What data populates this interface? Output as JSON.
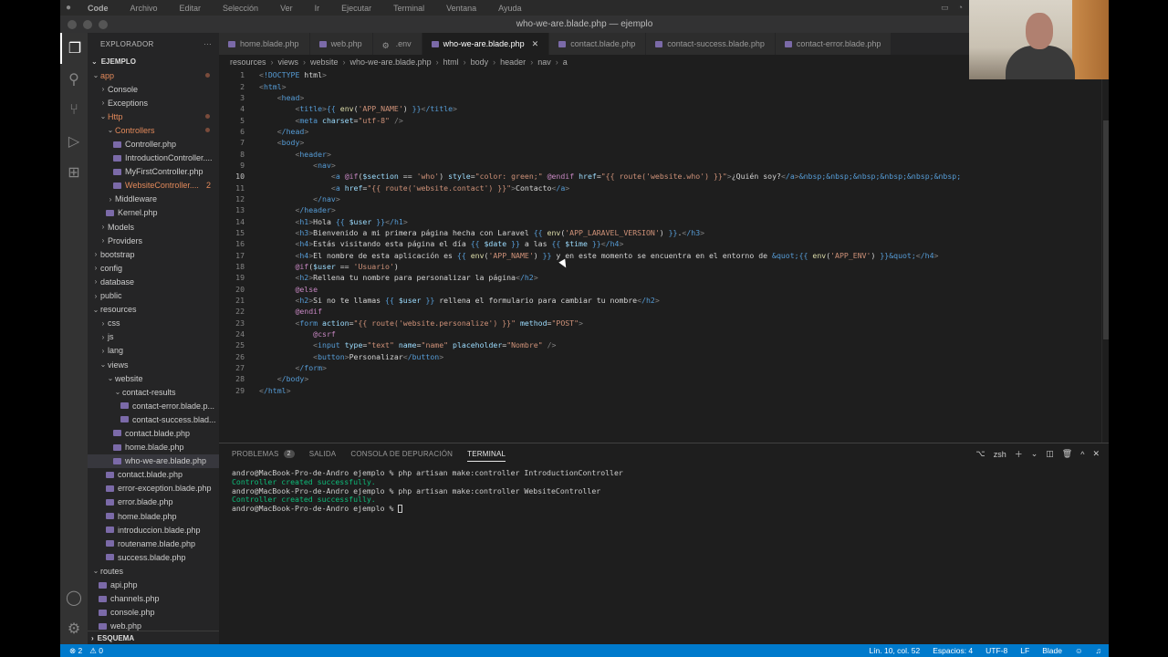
{
  "menubar": {
    "items": [
      "Code",
      "Archivo",
      "Editar",
      "Selección",
      "Ver",
      "Ir",
      "Ejecutar",
      "Terminal",
      "Ventana",
      "Ayuda"
    ]
  },
  "window": {
    "title": "who-we-are.blade.php — ejemplo"
  },
  "sidebar": {
    "header": "EXPLORADOR",
    "project": "EJEMPLO",
    "outline": "ESQUEMA",
    "tree": [
      {
        "label": "app",
        "depth": 0,
        "type": "folder-open",
        "orange": true,
        "dot": true
      },
      {
        "label": "Console",
        "depth": 1,
        "type": "folder"
      },
      {
        "label": "Exceptions",
        "depth": 1,
        "type": "folder"
      },
      {
        "label": "Http",
        "depth": 1,
        "type": "folder-open",
        "orange": true,
        "dot": true
      },
      {
        "label": "Controllers",
        "depth": 2,
        "type": "folder-open",
        "orange": true,
        "dot": true
      },
      {
        "label": "Controller.php",
        "depth": 3,
        "type": "file"
      },
      {
        "label": "IntroductionController....",
        "depth": 3,
        "type": "file"
      },
      {
        "label": "MyFirstController.php",
        "depth": 3,
        "type": "file"
      },
      {
        "label": "WebsiteController....",
        "depth": 3,
        "type": "file",
        "orange": true,
        "badge": "2"
      },
      {
        "label": "Middleware",
        "depth": 2,
        "type": "folder"
      },
      {
        "label": "Kernel.php",
        "depth": 2,
        "type": "file"
      },
      {
        "label": "Models",
        "depth": 1,
        "type": "folder"
      },
      {
        "label": "Providers",
        "depth": 1,
        "type": "folder"
      },
      {
        "label": "bootstrap",
        "depth": 0,
        "type": "folder"
      },
      {
        "label": "config",
        "depth": 0,
        "type": "folder"
      },
      {
        "label": "database",
        "depth": 0,
        "type": "folder"
      },
      {
        "label": "public",
        "depth": 0,
        "type": "folder"
      },
      {
        "label": "resources",
        "depth": 0,
        "type": "folder-open"
      },
      {
        "label": "css",
        "depth": 1,
        "type": "folder"
      },
      {
        "label": "js",
        "depth": 1,
        "type": "folder"
      },
      {
        "label": "lang",
        "depth": 1,
        "type": "folder"
      },
      {
        "label": "views",
        "depth": 1,
        "type": "folder-open"
      },
      {
        "label": "website",
        "depth": 2,
        "type": "folder-open"
      },
      {
        "label": "contact-results",
        "depth": 3,
        "type": "folder-open"
      },
      {
        "label": "contact-error.blade.p...",
        "depth": 4,
        "type": "file"
      },
      {
        "label": "contact-success.blad...",
        "depth": 4,
        "type": "file"
      },
      {
        "label": "contact.blade.php",
        "depth": 3,
        "type": "file"
      },
      {
        "label": "home.blade.php",
        "depth": 3,
        "type": "file"
      },
      {
        "label": "who-we-are.blade.php",
        "depth": 3,
        "type": "file",
        "selected": true
      },
      {
        "label": "contact.blade.php",
        "depth": 2,
        "type": "file"
      },
      {
        "label": "error-exception.blade.php",
        "depth": 2,
        "type": "file"
      },
      {
        "label": "error.blade.php",
        "depth": 2,
        "type": "file"
      },
      {
        "label": "home.blade.php",
        "depth": 2,
        "type": "file"
      },
      {
        "label": "introduccion.blade.php",
        "depth": 2,
        "type": "file"
      },
      {
        "label": "routename.blade.php",
        "depth": 2,
        "type": "file"
      },
      {
        "label": "success.blade.php",
        "depth": 2,
        "type": "file"
      },
      {
        "label": "routes",
        "depth": 0,
        "type": "folder-open"
      },
      {
        "label": "api.php",
        "depth": 1,
        "type": "file"
      },
      {
        "label": "channels.php",
        "depth": 1,
        "type": "file"
      },
      {
        "label": "console.php",
        "depth": 1,
        "type": "file"
      },
      {
        "label": "web.php",
        "depth": 1,
        "type": "file"
      }
    ]
  },
  "tabs": [
    {
      "label": "home.blade.php",
      "active": false
    },
    {
      "label": "web.php",
      "active": false
    },
    {
      "label": ".env",
      "active": false
    },
    {
      "label": "who-we-are.blade.php",
      "active": true
    },
    {
      "label": "contact.blade.php",
      "active": false
    },
    {
      "label": "contact-success.blade.php",
      "active": false
    },
    {
      "label": "contact-error.blade.php",
      "active": false
    }
  ],
  "breadcrumb": [
    "resources",
    "views",
    "website",
    "who-we-are.blade.php",
    "html",
    "body",
    "header",
    "nav",
    "a"
  ],
  "editor": {
    "current_line": 10,
    "lines": [
      "<!DOCTYPE html>",
      "<html>",
      "    <head>",
      "        <title>{{ env('APP_NAME') }}</title>",
      "        <meta charset=\"utf-8\" />",
      "    </head>",
      "    <body>",
      "        <header>",
      "            <nav>",
      "                <a @if($section == 'who') style=\"color: green;\" @endif href=\"{{ route('website.who') }}\">¿Quién soy?</a>&nbsp;&nbsp;&nbsp;&nbsp;&nbsp;&nbsp;",
      "                <a href=\"{{ route('website.contact') }}\">Contacto</a>",
      "            </nav>",
      "        </header>",
      "        <h1>Hola {{ $user }}</h1>",
      "        <h3>Bienvenido a mi primera página hecha con Laravel {{ env('APP_LARAVEL_VERSION') }}.</h3>",
      "        <h4>Estás visitando esta página el día {{ $date }} a las {{ $time }}</h4>",
      "        <h4>El nombre de esta aplicación es {{ env('APP_NAME') }} y en este momento se encuentra en el entorno de &quot;{{ env('APP_ENV') }}&quot;</h4>",
      "        @if($user == 'Usuario')",
      "        <h2>Rellena tu nombre para personalizar la página</h2>",
      "        @else",
      "        <h2>Si no te llamas {{ $user }} rellena el formulario para cambiar tu nombre</h2>",
      "        @endif",
      "        <form action=\"{{ route('website.personalize') }}\" method=\"POST\">",
      "            @csrf",
      "            <input type=\"text\" name=\"name\" placeholder=\"Nombre\" />",
      "            <button>Personalizar</button>",
      "        </form>",
      "    </body>",
      "</html>"
    ]
  },
  "panel": {
    "tabs": [
      {
        "label": "PROBLEMAS",
        "badge": "2"
      },
      {
        "label": "SALIDA"
      },
      {
        "label": "CONSOLA DE DEPURACIÓN"
      },
      {
        "label": "TERMINAL",
        "active": true
      }
    ],
    "shell": "zsh",
    "terminal_lines": [
      {
        "text": "andro@MacBook-Pro-de-Andro ejemplo % php artisan make:controller IntroductionController",
        "ok": false
      },
      {
        "text": "Controller created successfully.",
        "ok": true
      },
      {
        "text": "andro@MacBook-Pro-de-Andro ejemplo % php artisan make:controller WebsiteController",
        "ok": false
      },
      {
        "text": "Controller created successfully.",
        "ok": true
      },
      {
        "text": "andro@MacBook-Pro-de-Andro ejemplo % ",
        "ok": false,
        "cursor": true
      }
    ]
  },
  "statusbar": {
    "errors": "⊗ 2",
    "warnings": "⚠ 0",
    "position": "Lín. 10, col. 52",
    "spaces": "Espacios: 4",
    "encoding": "UTF-8",
    "eol": "LF",
    "language": "Blade"
  },
  "colors": {
    "statusbar": "#007acc",
    "editor_bg": "#1e1e1e",
    "sidebar_bg": "#252526",
    "modified": "#e2895a"
  }
}
